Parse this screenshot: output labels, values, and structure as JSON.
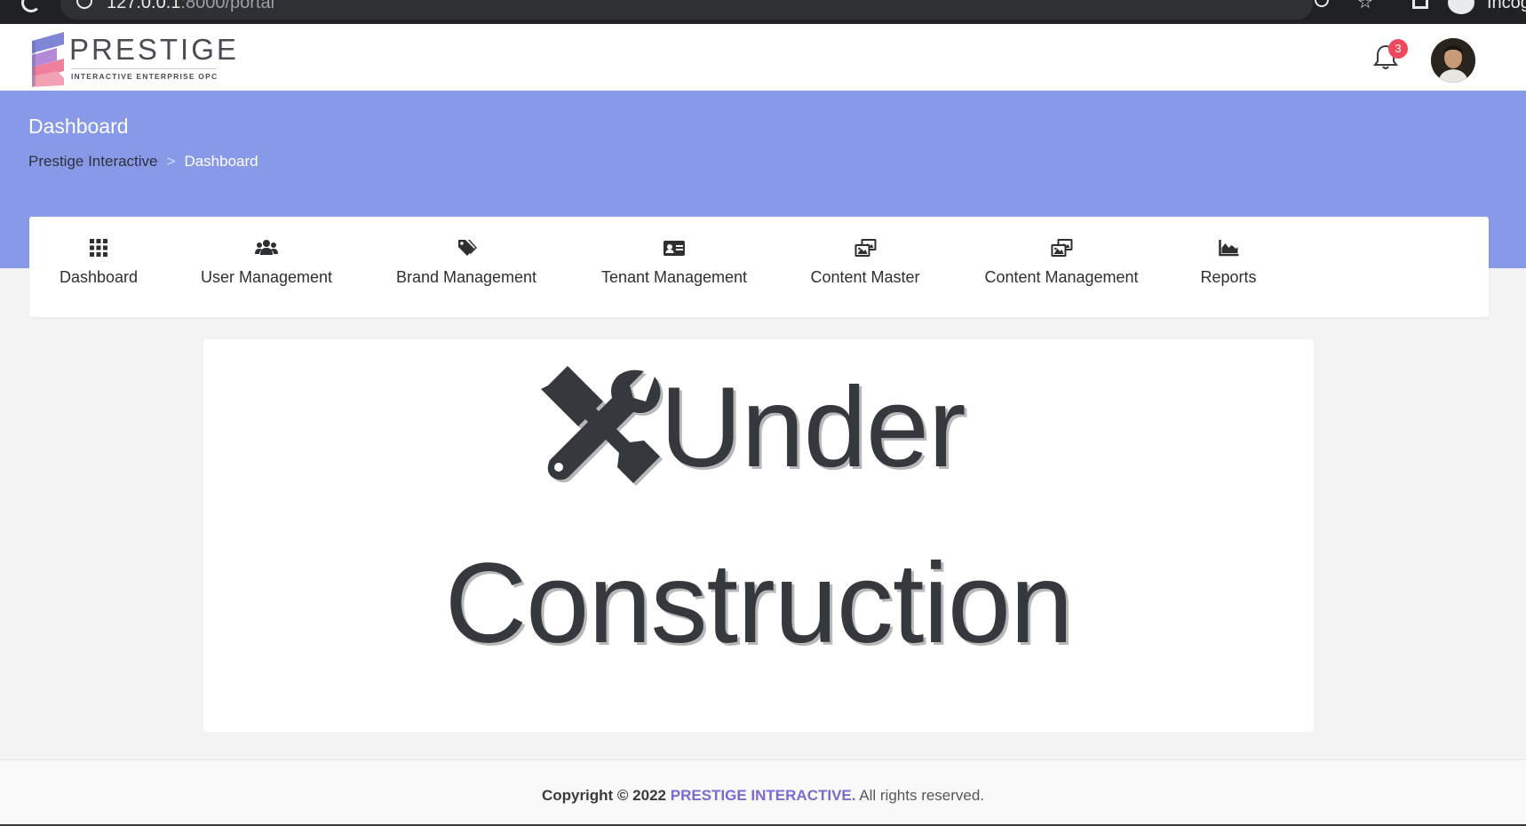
{
  "browser": {
    "url_host": "127.0.0.1",
    "url_rest": ":8000/portal",
    "profile_label": "Incog"
  },
  "header": {
    "logo_title": "PRESTIGE",
    "logo_subtitle": "INTERACTIVE ENTERPRISE OPC",
    "notification_count": "3",
    "logo_colors": [
      "#7f86d6",
      "#b48ad6",
      "#ef7f9b"
    ]
  },
  "title_band": {
    "title": "Dashboard",
    "breadcrumb": {
      "root": "Prestige Interactive",
      "separator": ">",
      "current": "Dashboard"
    },
    "color": "#8799e7"
  },
  "nav": {
    "items": [
      {
        "label": "Dashboard",
        "icon": "grid-icon"
      },
      {
        "label": "User Management",
        "icon": "users-icon"
      },
      {
        "label": "Brand Management",
        "icon": "tags-icon"
      },
      {
        "label": "Tenant Management",
        "icon": "id-card-icon"
      },
      {
        "label": "Content Master",
        "icon": "images-icon"
      },
      {
        "label": "Content Management",
        "icon": "images-icon"
      },
      {
        "label": "Reports",
        "icon": "area-chart-icon"
      }
    ]
  },
  "main": {
    "heading_line1": "Under",
    "heading_line2": "Construction",
    "icon": "tools-icon"
  },
  "footer": {
    "copyright": "Copyright © 2022",
    "brand": "PRESTIGE INTERACTIVE.",
    "rights": "All rights reserved.",
    "brand_color": "#7a6bd0"
  }
}
